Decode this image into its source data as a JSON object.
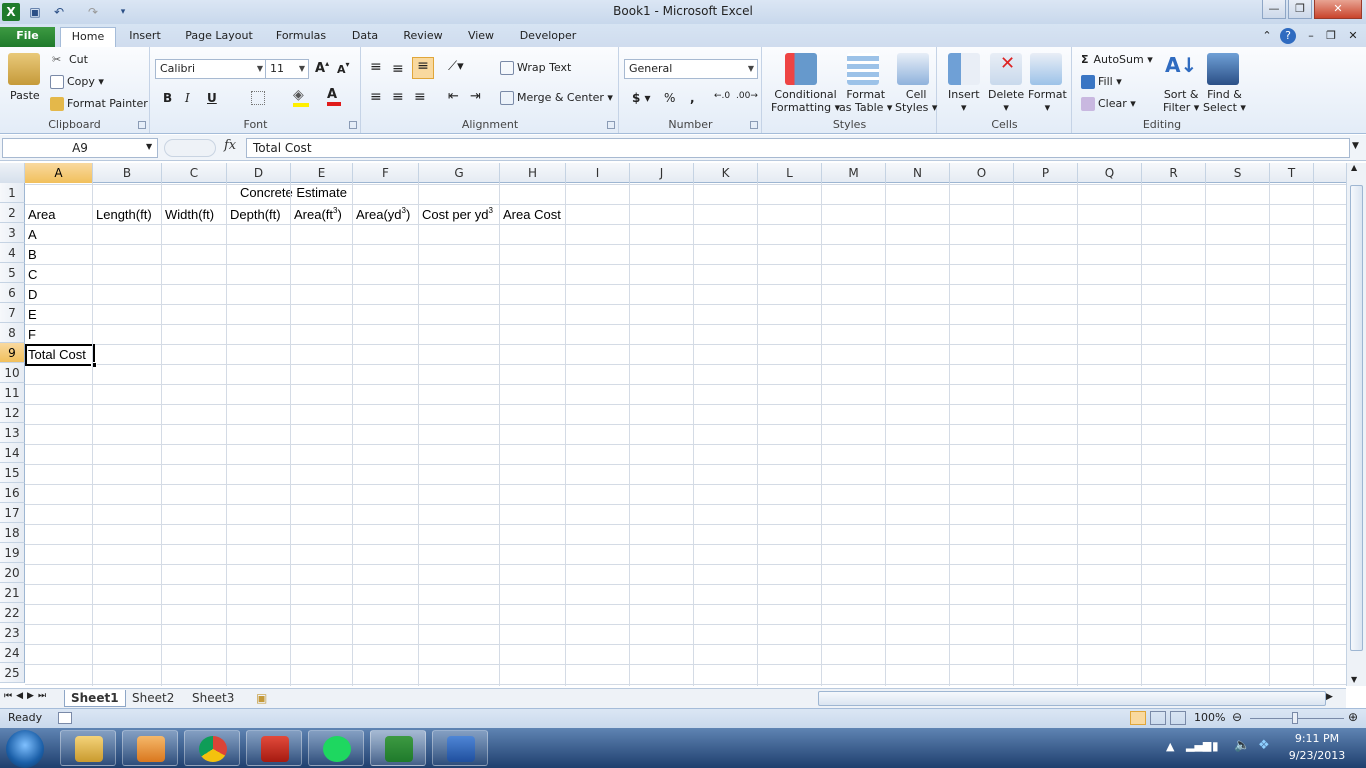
{
  "window": {
    "title": "Book1  -  Microsoft Excel"
  },
  "tabs": [
    {
      "label": "File"
    },
    {
      "label": "Home"
    },
    {
      "label": "Insert"
    },
    {
      "label": "Page Layout"
    },
    {
      "label": "Formulas"
    },
    {
      "label": "Data"
    },
    {
      "label": "Review"
    },
    {
      "label": "View"
    },
    {
      "label": "Developer"
    }
  ],
  "ribbon": {
    "clipboard": {
      "label": "Clipboard",
      "paste": "Paste",
      "cut": "Cut",
      "copy": "Copy",
      "format_painter": "Format Painter"
    },
    "font": {
      "label": "Font",
      "name": "Calibri",
      "size": "11",
      "bold": "B",
      "italic": "I",
      "underline": "U"
    },
    "alignment": {
      "label": "Alignment",
      "wrap_text": "Wrap Text",
      "merge_center": "Merge & Center"
    },
    "number": {
      "label": "Number",
      "format": "General",
      "currency": "$",
      "percent": "%",
      "comma": ","
    },
    "styles": {
      "label": "Styles",
      "conditional_1": "Conditional",
      "conditional_2": "Formatting",
      "format_table_1": "Format",
      "format_table_2": "as Table",
      "cell_styles_1": "Cell",
      "cell_styles_2": "Styles"
    },
    "cells": {
      "label": "Cells",
      "insert": "Insert",
      "delete": "Delete",
      "format": "Format"
    },
    "editing": {
      "label": "Editing",
      "autosum": "AutoSum",
      "fill": "Fill",
      "clear": "Clear",
      "sort_1": "Sort &",
      "sort_2": "Filter",
      "find_1": "Find &",
      "find_2": "Select"
    }
  },
  "formula_bar": {
    "name_box": "A9",
    "fx": "fx",
    "content": "Total Cost"
  },
  "columns": [
    "A",
    "B",
    "C",
    "D",
    "E",
    "F",
    "G",
    "H",
    "I",
    "J",
    "K",
    "L",
    "M",
    "N",
    "O",
    "P",
    "Q",
    "R",
    "S",
    "T"
  ],
  "rows": [
    "1",
    "2",
    "3",
    "4",
    "5",
    "6",
    "7",
    "8",
    "9",
    "10",
    "11",
    "12",
    "13",
    "14",
    "15",
    "16",
    "17",
    "18",
    "19",
    "20",
    "21",
    "22",
    "23",
    "24",
    "25"
  ],
  "cells": {
    "title": "Concrete Estimate",
    "headers": {
      "area": "Area",
      "length": "Length(ft)",
      "width": "Width(ft)",
      "depth": "Depth(ft)",
      "area_ft_base": "Area(ft",
      "area_ft_sup": "3",
      "area_ft_close": ")",
      "area_yd_base": "Area(yd",
      "area_yd_sup": "3",
      "area_yd_close": ")",
      "cost_base": "Cost per yd",
      "cost_sup": "3",
      "area_cost": "Area Cost"
    },
    "areas": [
      "A",
      "B",
      "C",
      "D",
      "E",
      "F"
    ],
    "total": "Total Cost"
  },
  "sheets": [
    "Sheet1",
    "Sheet2",
    "Sheet3"
  ],
  "status": {
    "ready": "Ready",
    "zoom": "100%"
  },
  "taskbar": {
    "time": "9:11 PM",
    "date": "9/23/2013"
  }
}
